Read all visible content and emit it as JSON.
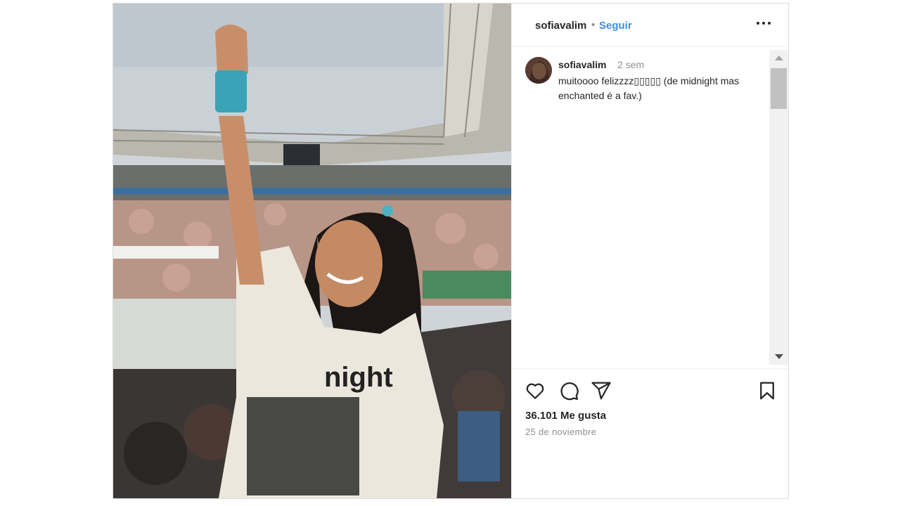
{
  "post": {
    "username": "sofiavalim",
    "separator": "•",
    "follow_label": "Seguir",
    "more_icon": "more-options-icon",
    "image_alt": "photo at stadium concert"
  },
  "caption": {
    "username": "sofiavalim",
    "time_ago": "2 sem",
    "text": "muitoooo felizzzz▯▯▯▯▯ (de midnight mas enchanted é a fav.)"
  },
  "actions": {
    "like_icon": "heart-icon",
    "comment_icon": "comment-icon",
    "share_icon": "share-icon",
    "save_icon": "bookmark-icon"
  },
  "stats": {
    "likes_label": "36.101 Me gusta",
    "date_label": "25 de noviembre"
  },
  "colors": {
    "follow": "#3c8ee6",
    "muted": "#8e8e8e",
    "text": "#262626"
  }
}
